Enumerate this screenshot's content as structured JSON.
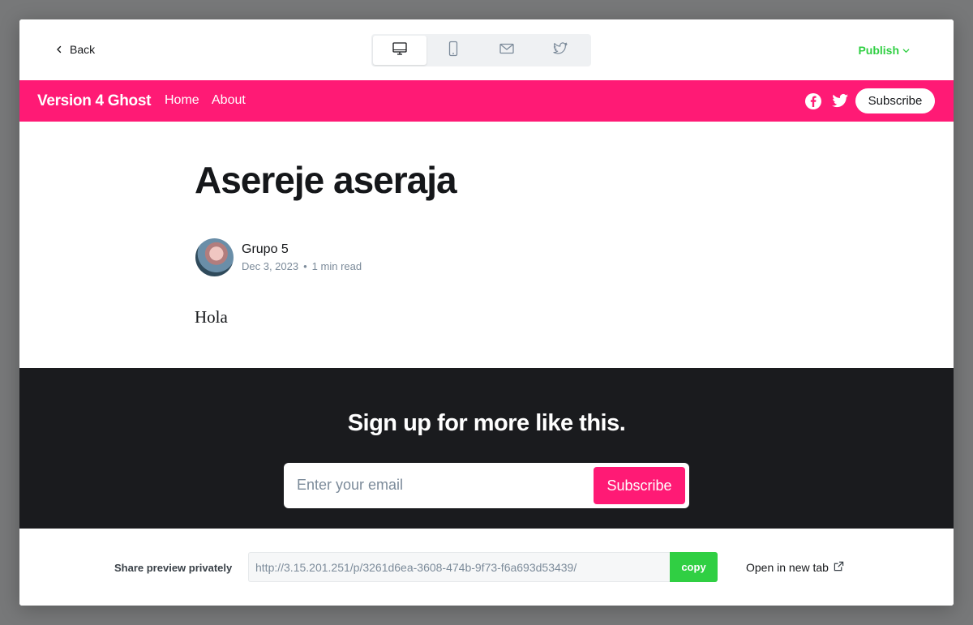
{
  "topbar": {
    "back_label": "Back",
    "devices": [
      {
        "icon": "desktop-icon",
        "active": true
      },
      {
        "icon": "mobile-icon",
        "active": false
      },
      {
        "icon": "email-icon",
        "active": false
      },
      {
        "icon": "twitter-icon",
        "active": false
      }
    ],
    "publish_label": "Publish"
  },
  "site": {
    "title": "Version 4 Ghost",
    "nav": [
      "Home",
      "About"
    ],
    "subscribe_label": "Subscribe",
    "accent_color": "#ff1a75"
  },
  "post": {
    "title": "Asereje aseraja",
    "author": "Grupo 5",
    "date": "Dec 3, 2023",
    "separator": "•",
    "read_time": "1 min read",
    "body": "Hola"
  },
  "cta": {
    "title": "Sign up for more like this.",
    "email_placeholder": "Enter your email",
    "button_label": "Subscribe"
  },
  "share": {
    "label": "Share preview privately",
    "url": "http://3.15.201.251/p/3261d6ea-3608-474b-9f73-f6a693d53439/",
    "copy_label": "copy",
    "open_label": "Open in new tab"
  },
  "colors": {
    "publish": "#30cf43",
    "cta_bg": "#1a1b1e"
  }
}
